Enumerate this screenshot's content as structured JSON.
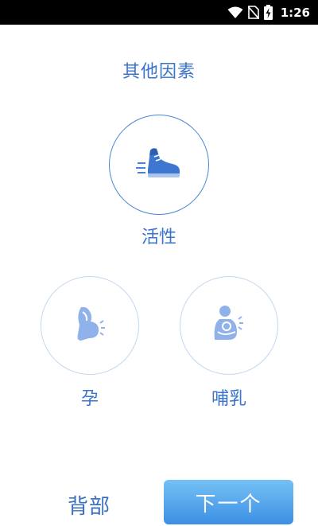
{
  "status_bar": {
    "time": "1:26",
    "icons": [
      "wifi-icon",
      "no-sim-icon",
      "battery-charging-icon"
    ]
  },
  "page": {
    "title": "其他因素"
  },
  "options": {
    "activity": {
      "label": "活性",
      "icon": "sneaker-icon",
      "selected": true
    },
    "pregnancy": {
      "label": "孕",
      "icon": "pregnant-icon",
      "selected": false
    },
    "breastfeeding": {
      "label": "哺乳",
      "icon": "breastfeeding-icon",
      "selected": false
    }
  },
  "footer": {
    "back_label": "背部",
    "next_label": "下一个"
  },
  "colors": {
    "accent": "#3a74c9",
    "icon_fill": "#8fb2ea",
    "next_button_top": "#74c1f5",
    "next_button_bottom": "#3d8fe4"
  }
}
